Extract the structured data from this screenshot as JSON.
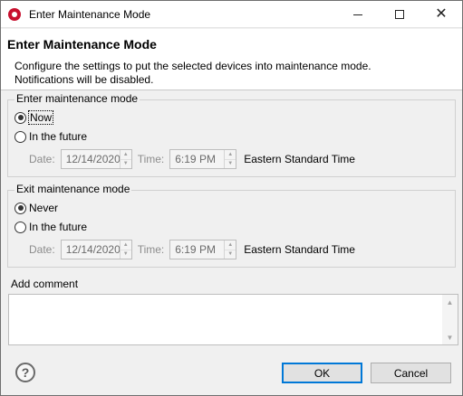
{
  "window": {
    "title": "Enter Maintenance Mode",
    "close_glyph": "✕"
  },
  "header": {
    "title": "Enter Maintenance Mode",
    "description_line1": "Configure the settings to put the selected devices into maintenance mode.",
    "description_line2": "Notifications will be disabled."
  },
  "enter_group": {
    "label": "Enter maintenance mode",
    "option_now": "Now",
    "option_future": "In the future",
    "selected": "Now",
    "date_label": "Date:",
    "date_value": "12/14/2020",
    "time_label": "Time:",
    "time_value": "6:19 PM",
    "timezone": "Eastern Standard Time"
  },
  "exit_group": {
    "label": "Exit maintenance mode",
    "option_never": "Never",
    "option_future": "In the future",
    "selected": "Never",
    "date_label": "Date:",
    "date_value": "12/14/2020",
    "time_label": "Time:",
    "time_value": "6:19 PM",
    "timezone": "Eastern Standard Time"
  },
  "comment": {
    "label": "Add comment",
    "value": ""
  },
  "footer": {
    "help_glyph": "?",
    "ok_label": "OK",
    "cancel_label": "Cancel"
  },
  "spinner": {
    "up": "▲",
    "down": "▼"
  },
  "colors": {
    "app_icon": "#c8102e",
    "default_button_border": "#0078d7"
  }
}
